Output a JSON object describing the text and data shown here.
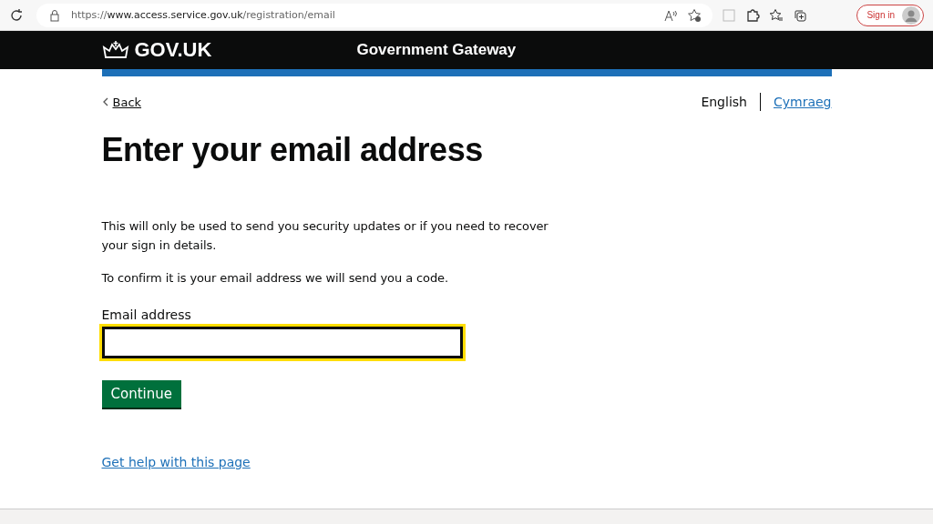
{
  "browser": {
    "url_host": "https://www.access.service.gov.uk",
    "url_path": "/registration/email",
    "sign_in": "Sign in"
  },
  "header": {
    "logo": "GOV.UK",
    "service": "Government Gateway"
  },
  "back": "Back",
  "languages": [
    {
      "label": "English",
      "selected": true
    },
    {
      "label": "Cymraeg",
      "selected": false
    }
  ],
  "title": "Enter your email address",
  "paragraphs": [
    "This will only be used to send you security updates or if you need to recover your sign in details.",
    "To confirm it is your email address we will send you a code."
  ],
  "field": {
    "label": "Email address",
    "focused": true
  },
  "button": "Continue",
  "help_link": "Get help with this page"
}
